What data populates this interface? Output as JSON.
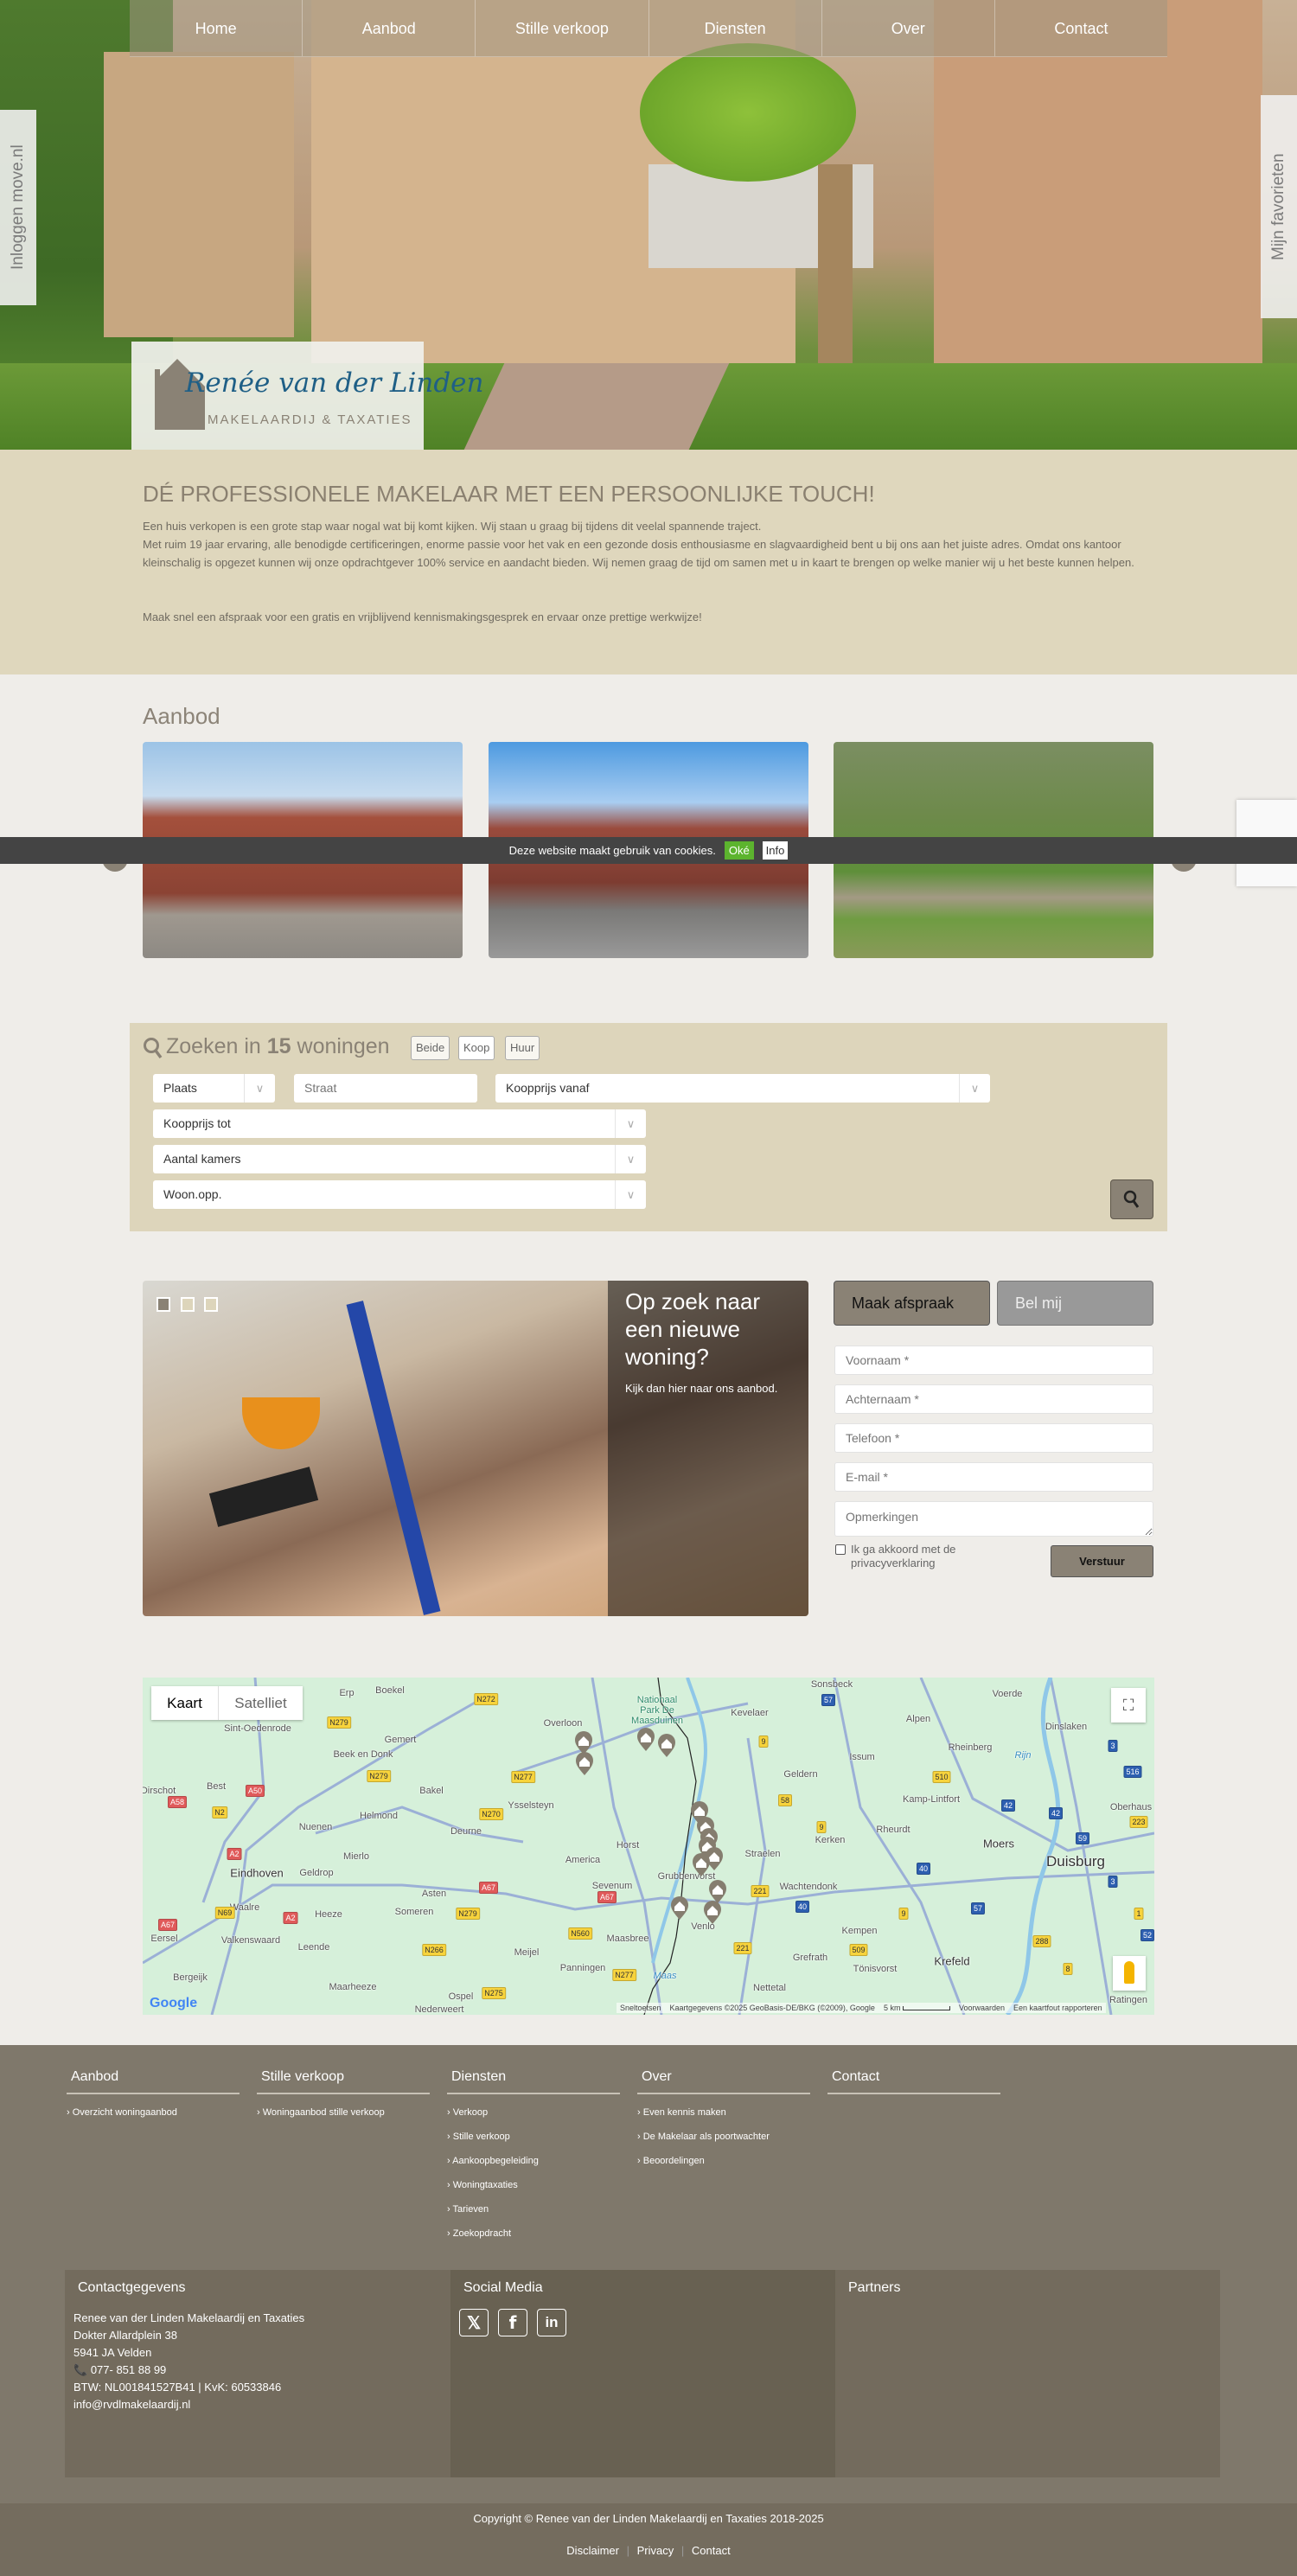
{
  "nav": {
    "items": [
      "Home",
      "Aanbod",
      "Stille verkoop",
      "Diensten",
      "Over",
      "Contact"
    ]
  },
  "side_tabs": {
    "login": "Inloggen move.nl",
    "favorites": "Mijn favorieten"
  },
  "logo": {
    "name": "Renée van der Linden",
    "tagline": "MAKELAARDIJ & TAXATIES"
  },
  "intro": {
    "title": "DÉ PROFESSIONELE MAKELAAR MET EEN PERSOONLIJKE TOUCH!",
    "p1": "Een huis verkopen is een grote stap waar nogal wat bij komt kijken. Wij staan u graag bij tijdens dit veelal spannende traject.",
    "p2": "Met ruim 19 jaar ervaring, alle benodigde certificeringen, enorme passie voor het vak en een gezonde dosis enthousiasme en slagvaardigheid bent u bij ons aan het juiste adres. Omdat ons kantoor kleinschalig is opgezet kunnen wij onze opdrachtgever 100% service en aandacht bieden. Wij nemen graag de tijd om samen met u in kaart te brengen op welke manier wij u het beste kunnen helpen.",
    "p3": "Maak snel een afspraak voor een gratis en vrijblijvend kennismakingsgesprek en ervaar onze prettige werkwijze!"
  },
  "aanbod": {
    "title": "Aanbod"
  },
  "cookie": {
    "text": "Deze website maakt gebruik van cookies.",
    "ok": "Oké",
    "info": "Info"
  },
  "search": {
    "prefix": "Zoeken in ",
    "count": "15",
    "suffix": " woningen",
    "types": [
      "Beide",
      "Koop",
      "Huur"
    ],
    "plaats": "Plaats",
    "straat_placeholder": "Straat",
    "prijs_vanaf": "Koopprijs vanaf",
    "prijs_tot": "Koopprijs tot",
    "kamers": "Aantal kamers",
    "opp": "Woon.opp."
  },
  "slider": {
    "title": "Op zoek naar een nieuwe woning?",
    "text": "Kijk dan hier naar ons aanbod.",
    "active_slide": 1,
    "slide_count": 3
  },
  "form": {
    "tab_active": "Maak afspraak",
    "tab_other": "Bel mij",
    "voornaam": "Voornaam *",
    "achternaam": "Achternaam *",
    "telefoon": "Telefoon *",
    "email": "E-mail *",
    "opmerkingen": "Opmerkingen",
    "privacy": "Ik ga akkoord met de privacyverklaring",
    "submit": "Verstuur"
  },
  "map": {
    "type_map": "Kaart",
    "type_satellite": "Satelliet",
    "google": "Google",
    "attribution": [
      "Sneltoetsen",
      "Kaartgegevens ©2025 GeoBasis-DE/BKG (©2009), Google",
      "5 km",
      "Voorwaarden",
      "Een kaartfout rapporteren"
    ],
    "places": [
      "Sint-Oedenrode",
      "Gemert",
      "Overloon",
      "Beek en Donk",
      "Bakel",
      "Best",
      "Dirschot",
      "Helmond",
      "Ysselsteyn",
      "Deurne",
      "Nuenen",
      "Mierlo",
      "Eindhoven",
      "Geldrop",
      "Horst",
      "America",
      "Sevenum",
      "Grubbenvorst",
      "Asten",
      "Waalre",
      "Heeze",
      "Someren",
      "Valkenswaard",
      "Leende",
      "Eersel",
      "Bergeijk",
      "Maarheeze",
      "Meijel",
      "Maasbree",
      "Panningen",
      "Ospel",
      "Nederweert",
      "Venlo",
      "Erp",
      "Boekel",
      "Nationaal Park De Maasduinen",
      "Kevelaer",
      "Sonsbeck",
      "Alpen",
      "Voerde",
      "Dinslaken",
      "Rheinberg",
      "Issum",
      "Geldern",
      "Kamp-Lintfort",
      "Oberhaus",
      "Rheurdt",
      "Kerken",
      "Moers",
      "Straelen",
      "Duisburg",
      "Wachtendonk",
      "Kempen",
      "Krefeld",
      "Grefrath",
      "Tönisvorst",
      "Nettetal",
      "Ratingen",
      "Maas",
      "Rijn"
    ],
    "roads": [
      "N272",
      "N279",
      "N279",
      "N277",
      "N270",
      "A50",
      "A58",
      "N2",
      "A2",
      "A67",
      "A67",
      "N69",
      "A2",
      "A67",
      "N279",
      "N266",
      "N560",
      "N277",
      "N275",
      "57",
      "9",
      "58",
      "510",
      "42",
      "42",
      "223",
      "59",
      "40",
      "40",
      "221",
      "221",
      "9",
      "9",
      "57",
      "509",
      "288",
      "8",
      "1",
      "3",
      "52",
      "3",
      "516"
    ]
  },
  "footer": {
    "columns": [
      {
        "title": "Aanbod",
        "links": [
          "Overzicht woningaanbod"
        ]
      },
      {
        "title": "Stille verkoop",
        "links": [
          "Woningaanbod stille verkoop"
        ]
      },
      {
        "title": "Diensten",
        "links": [
          "Verkoop",
          "Stille verkoop",
          "Aankoopbegeleiding",
          "Woningtaxaties",
          "Tarieven",
          "Zoekopdracht"
        ]
      },
      {
        "title": "Over",
        "links": [
          "Even kennis maken",
          "De Makelaar als poortwachter",
          "Beoordelingen"
        ]
      },
      {
        "title": "Contact",
        "links": []
      }
    ],
    "contact": {
      "title": "Contactgegevens",
      "name": "Renee van der Linden Makelaardij en Taxaties",
      "street": "Dokter Allardplein 38",
      "city": "5941 JA Velden",
      "phone": "077- 851 88 99",
      "btw": "BTW: NL001841527B41 | KvK: 60533846",
      "email": "info@rvdlmakelaardij.nl"
    },
    "social": {
      "title": "Social Media",
      "icons": [
        "x-icon",
        "facebook-icon",
        "linkedin-icon"
      ]
    },
    "partners": {
      "title": "Partners"
    },
    "copyright": "Copyright © Renee van der Linden Makelaardij en Taxaties 2018-2025",
    "bottom_links": [
      "Disclaimer",
      "Privacy",
      "Contact"
    ]
  },
  "colors": {
    "beige": "#dfd7bd",
    "taupe": "#8a8275",
    "footer": "#7f786b",
    "cookie_ok": "#5cb42e"
  }
}
